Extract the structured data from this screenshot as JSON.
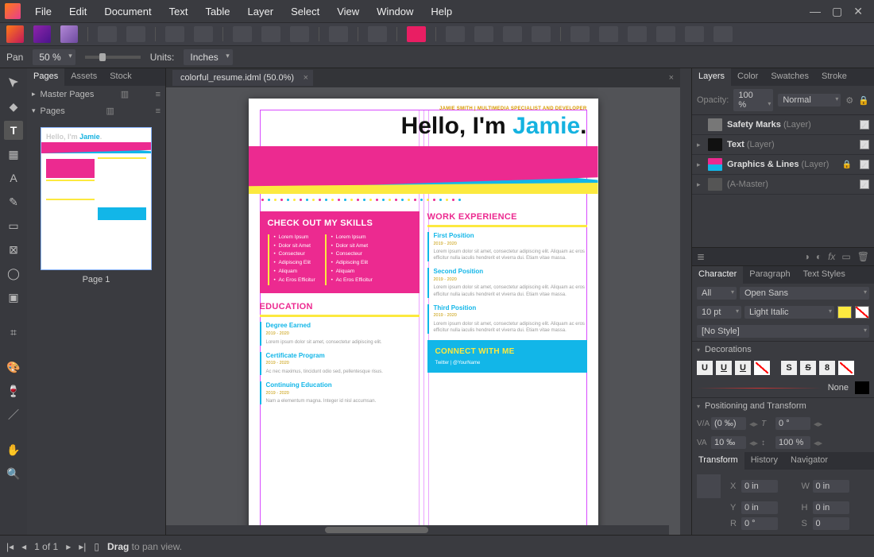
{
  "menu": [
    "File",
    "Edit",
    "Document",
    "Text",
    "Table",
    "Layer",
    "Select",
    "View",
    "Window",
    "Help"
  ],
  "contextbar": {
    "pan_label": "Pan",
    "zoom": "50 %",
    "units_label": "Units:",
    "units_value": "Inches"
  },
  "left_panel": {
    "tabs": [
      "Pages",
      "Assets",
      "Stock"
    ],
    "master_label": "Master Pages",
    "pages_label": "Pages",
    "thumb_caption": "Page 1"
  },
  "doc_tab": {
    "label": "colorful_resume.idml (50.0%)"
  },
  "resume": {
    "tagline": "JAMIE SMITH | MULTIMEDIA SPECIALIST AND DEVELOPER",
    "hello_pre": "Hello, I'm ",
    "hello_name": "Jamie",
    "skills_title": "CHECK OUT MY SKILLS",
    "skills": [
      "Lorem Ipsum",
      "Dolor sit Amet",
      "Consecteur",
      "Adipiscing Elit",
      "Aliquam",
      "Ac Eros Efficitur"
    ],
    "edu_title": "EDUCATION",
    "edu": [
      {
        "name": "Degree Earned",
        "date": "2019 - 2020",
        "text": "Lorem ipsum dolor sit amet, consectetur adipiscing elit."
      },
      {
        "name": "Certificate Program",
        "date": "2019 - 2020",
        "text": "Ac nec maximus, tincidunt odio sed, pellentesque risus."
      },
      {
        "name": "Continuing Education",
        "date": "2019 - 2020",
        "text": "Nam a elementum magna. Integer id nisl accumsan."
      }
    ],
    "work_title": "WORK EXPERIENCE",
    "work": [
      {
        "name": "First Position",
        "date": "2019 - 2020",
        "text": "Lorem ipsum dolor sit amet, consectetur adipiscing elit. Aliquam ac eros efficitur nulla iaculis hendrerit et viverra dui. Etiam vitae massa."
      },
      {
        "name": "Second Position",
        "date": "2019 - 2020",
        "text": "Lorem ipsum dolor sit amet, consectetur adipiscing elit. Aliquam ac eros efficitur nulla iaculis hendrerit et viverra dui. Etiam vitae massa."
      },
      {
        "name": "Third Position",
        "date": "2019 - 2020",
        "text": "Lorem ipsum dolor sit amet, consectetur adipiscing elit. Aliquam ac eros efficitur nulla iaculis hendrerit et viverra dui. Etiam vitae massa."
      }
    ],
    "connect_title": "CONNECT WITH ME",
    "connect_text": "Twitter | @YourName"
  },
  "layers_panel": {
    "tabs": [
      "Layers",
      "Color",
      "Swatches",
      "Stroke"
    ],
    "opacity_label": "Opacity:",
    "opacity": "100 %",
    "blend": "Normal",
    "layers": [
      {
        "name": "Safety Marks",
        "suffix": "(Layer)",
        "icon": "#888"
      },
      {
        "name": "Text",
        "suffix": "(Layer)",
        "icon": "#222"
      },
      {
        "name": "Graphics & Lines",
        "suffix": "(Layer)",
        "icon": "#ec2a90",
        "locked": true
      },
      {
        "name": "(A-Master)",
        "suffix": "",
        "icon": "#555"
      }
    ]
  },
  "char_panel": {
    "tabs": [
      "Character",
      "Paragraph",
      "Text Styles"
    ],
    "collection": "All",
    "font": "Open Sans",
    "size": "10 pt",
    "style": "Light Italic",
    "textstyle": "[No Style]",
    "decorations_label": "Decorations",
    "none_label": "None",
    "positioning_label": "Positioning and Transform",
    "kern": "(0 ‰)",
    "kern_deg": "0 °",
    "track": "10 ‰",
    "scale": "100 %"
  },
  "transform_panel": {
    "tabs": [
      "Transform",
      "History",
      "Navigator"
    ],
    "x": "0 in",
    "y": "0 in",
    "w": "0 in",
    "h": "0 in",
    "r": "0 °",
    "s": "0"
  },
  "statusbar": {
    "page": "1 of 1",
    "hint_bold": "Drag",
    "hint_rest": " to pan view."
  }
}
